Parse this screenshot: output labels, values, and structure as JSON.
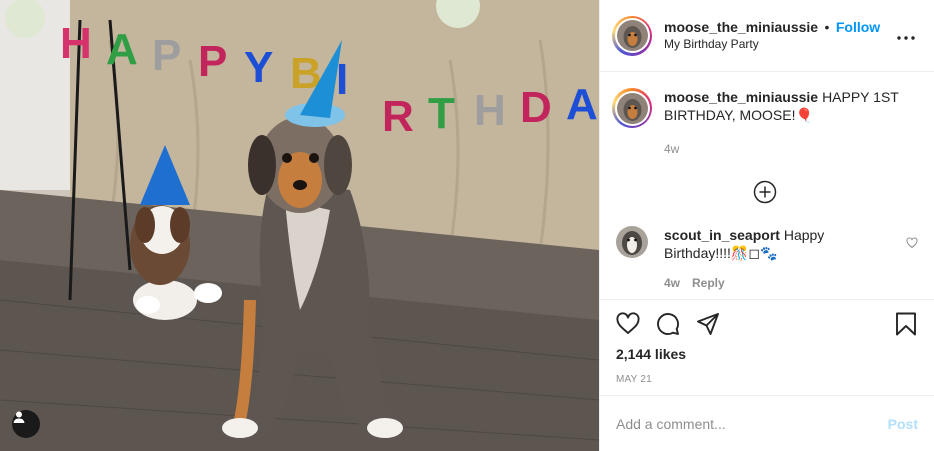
{
  "post": {
    "header": {
      "username": "moose_the_miniaussie",
      "separator": "•",
      "follow_label": "Follow",
      "location": "My Birthday Party",
      "more_icon": "more-options-icon"
    },
    "photo": {
      "banner_letters": [
        "H",
        "A",
        "P",
        "P",
        "Y",
        "B",
        "I",
        "R",
        "T",
        "H",
        "D",
        "A"
      ],
      "banner_colors": [
        "#d6336c",
        "#2f9e44",
        "#9e9e9e",
        "#c2255c",
        "#1c4fd6",
        "#c9a227",
        "#1c4fd6",
        "#c2255c",
        "#2f9e44",
        "#9e9e9e",
        "#c2255c",
        "#1c4fd6"
      ],
      "tag_icon": "user-tag-icon"
    },
    "caption": {
      "username": "moose_the_miniaussie",
      "text": "HAPPY 1ST BIRTHDAY, MOOSE!🎈",
      "time": "4w"
    },
    "load_more_icon": "plus-circle-icon",
    "comments": [
      {
        "username": "scout_in_seaport",
        "text": "Happy Birthday!!!!🎊◻🐾",
        "time": "4w",
        "reply_label": "Reply"
      }
    ],
    "actions": {
      "like_icon": "heart-icon",
      "comment_icon": "comment-icon",
      "share_icon": "share-icon",
      "save_icon": "bookmark-icon"
    },
    "likes": "2,144 likes",
    "date": "MAY 21",
    "add_comment": {
      "placeholder": "Add a comment...",
      "post_label": "Post"
    }
  }
}
